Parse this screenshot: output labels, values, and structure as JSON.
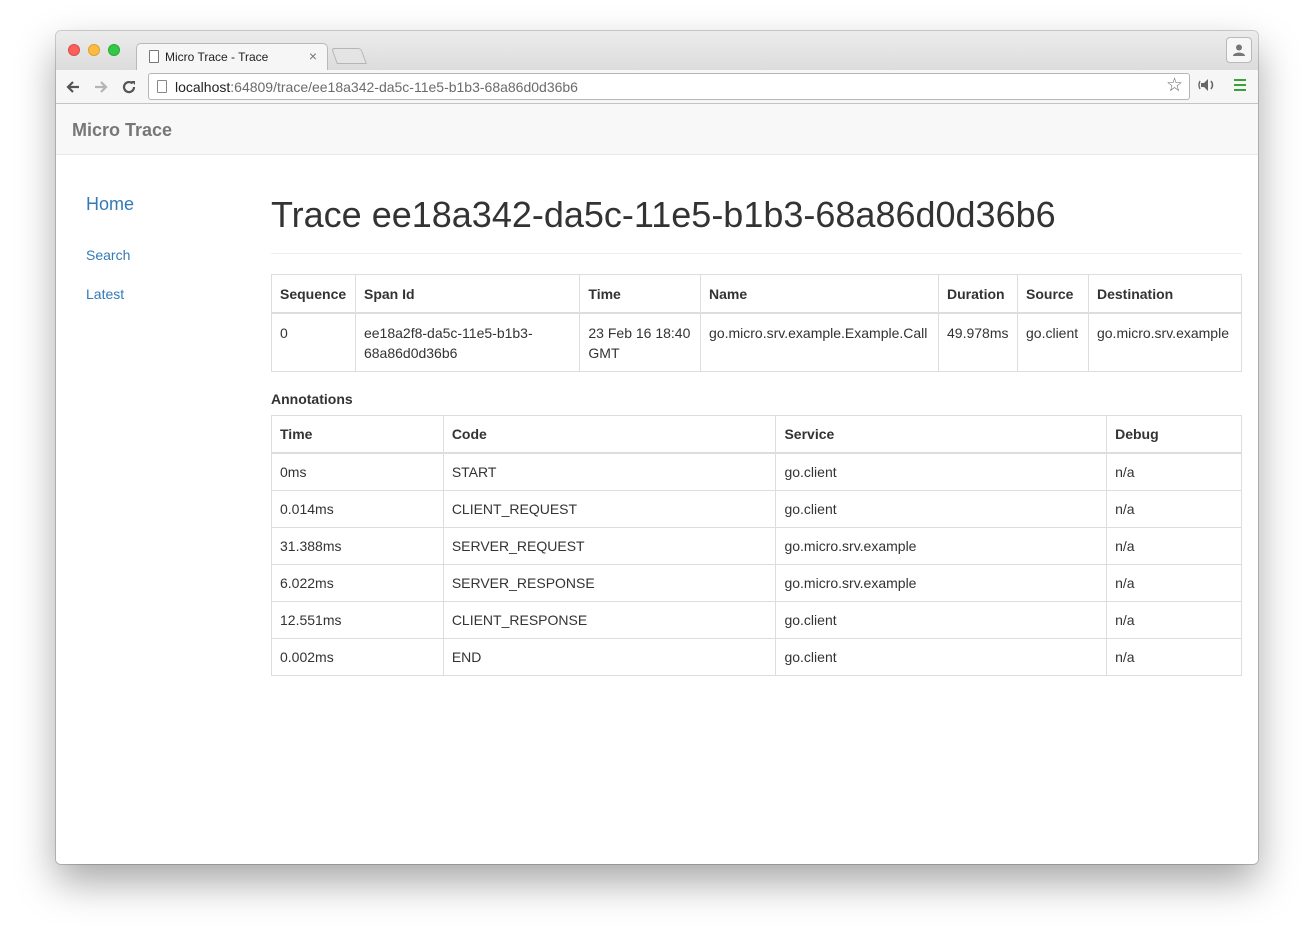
{
  "browser": {
    "tab_title": "Micro Trace - Trace",
    "tab_close": "×",
    "url_host": "localhost",
    "url_path": ":64809/trace/ee18a342-da5c-11e5-b1b3-68a86d0d36b6",
    "star": "☆"
  },
  "navbar": {
    "brand": "Micro Trace"
  },
  "sidebar": {
    "home": "Home",
    "links": [
      "Search",
      "Latest"
    ]
  },
  "main": {
    "title": "Trace ee18a342-da5c-11e5-b1b3-68a86d0d36b6",
    "spans": {
      "headers": [
        "Sequence",
        "Span Id",
        "Time",
        "Name",
        "Duration",
        "Source",
        "Destination"
      ],
      "rows": [
        [
          "0",
          "ee18a2f8-da5c-11e5-b1b3-68a86d0d36b6",
          "23 Feb 16 18:40 GMT",
          "go.micro.srv.example.Example.Call",
          "49.978ms",
          "go.client",
          "go.micro.srv.example"
        ]
      ]
    },
    "annotations_label": "Annotations",
    "annotations": {
      "headers": [
        "Time",
        "Code",
        "Service",
        "Debug"
      ],
      "rows": [
        [
          "0ms",
          "START",
          "go.client",
          "n/a"
        ],
        [
          "0.014ms",
          "CLIENT_REQUEST",
          "go.client",
          "n/a"
        ],
        [
          "31.388ms",
          "SERVER_REQUEST",
          "go.micro.srv.example",
          "n/a"
        ],
        [
          "6.022ms",
          "SERVER_RESPONSE",
          "go.micro.srv.example",
          "n/a"
        ],
        [
          "12.551ms",
          "CLIENT_RESPONSE",
          "go.client",
          "n/a"
        ],
        [
          "0.002ms",
          "END",
          "go.client",
          "n/a"
        ]
      ]
    }
  }
}
